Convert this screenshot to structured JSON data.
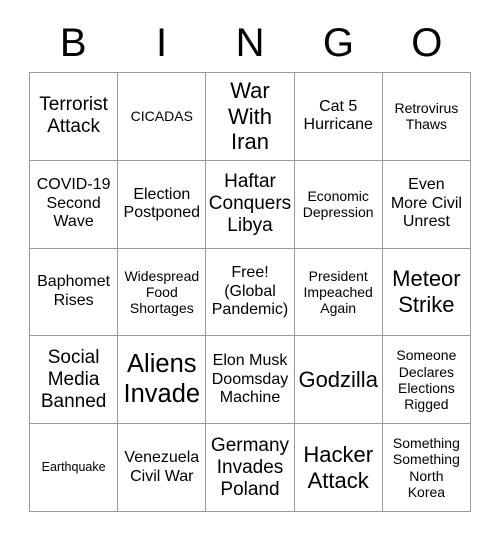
{
  "card": {
    "header_letters": [
      "B",
      "I",
      "N",
      "G",
      "O"
    ],
    "columns": 5,
    "rows": 5,
    "border_color": "#9a9a9a",
    "text_color": "#000000",
    "background_color": "#ffffff",
    "free_space_index": 12,
    "cells": [
      {
        "text": "Terrorist\nAttack",
        "size": "lg"
      },
      {
        "text": "CICADAS",
        "size": "sm"
      },
      {
        "text": "War\nWith\nIran",
        "size": "xl"
      },
      {
        "text": "Cat 5\nHurricane",
        "size": "md"
      },
      {
        "text": "Retrovirus\nThaws",
        "size": "sm"
      },
      {
        "text": "COVID-19\nSecond\nWave",
        "size": "md"
      },
      {
        "text": "Election\nPostponed",
        "size": "md"
      },
      {
        "text": "Haftar\nConquers\nLibya",
        "size": "lg"
      },
      {
        "text": "Economic\nDepression",
        "size": "sm"
      },
      {
        "text": "Even\nMore Civil\nUnrest",
        "size": "md"
      },
      {
        "text": "Baphomet\nRises",
        "size": "md"
      },
      {
        "text": "Widespread\nFood\nShortages",
        "size": "sm"
      },
      {
        "text": "Free!\n(Global\nPandemic)",
        "size": "md"
      },
      {
        "text": "President\nImpeached\nAgain",
        "size": "sm"
      },
      {
        "text": "Meteor\nStrike",
        "size": "xl"
      },
      {
        "text": "Social\nMedia\nBanned",
        "size": "lg"
      },
      {
        "text": "Aliens\nInvade",
        "size": "xxl"
      },
      {
        "text": "Elon Musk\nDoomsday\nMachine",
        "size": "md"
      },
      {
        "text": "Godzilla",
        "size": "xl"
      },
      {
        "text": "Someone\nDeclares\nElections\nRigged",
        "size": "sm"
      },
      {
        "text": "Earthquake",
        "size": "xs"
      },
      {
        "text": "Venezuela\nCivil War",
        "size": "md"
      },
      {
        "text": "Germany\nInvades\nPoland",
        "size": "lg"
      },
      {
        "text": "Hacker\nAttack",
        "size": "xl"
      },
      {
        "text": "Something\nSomething\nNorth\nKorea",
        "size": "sm"
      }
    ]
  }
}
